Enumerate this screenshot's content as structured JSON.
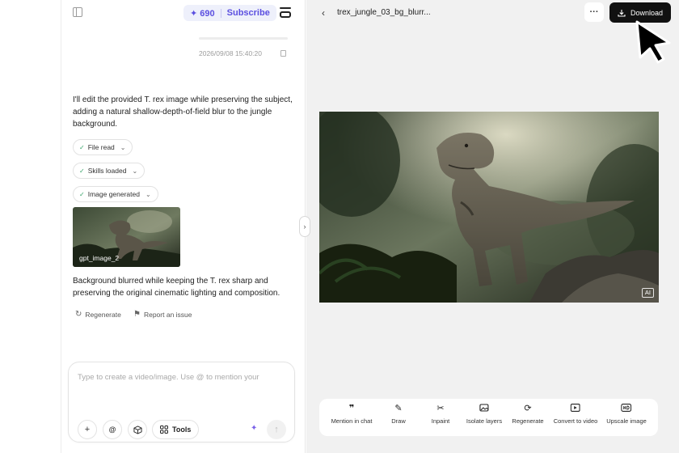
{
  "header": {
    "credits": "✦ 690",
    "subscribe_label": "Subscribe"
  },
  "chat": {
    "timestamp": "2026/09/08 15:40:20",
    "intro_text": "I'll edit the provided T. rex image while preserving the subject, adding a natural shallow-depth-of-field blur to the jungle background.",
    "steps": [
      {
        "label": "File read"
      },
      {
        "label": "Skills loaded"
      },
      {
        "label": "Image generated"
      }
    ],
    "thumbnail_label": "gpt_image_2",
    "result_text": "Background blurred while keeping the T. rex sharp and preserving the original cinematic lighting and composition.",
    "actions": {
      "regenerate": "Regenerate",
      "report": "Report an issue"
    }
  },
  "composer": {
    "placeholder": "Type to create a video/image. Use @ to mention your",
    "at_label": "@",
    "tools_label": "Tools"
  },
  "canvas": {
    "file_title": "trex_jungle_03_bg_blurr...",
    "more_label": "···",
    "download_label": "Download",
    "ai_badge": "AI",
    "tools": [
      {
        "label": "Mention in chat",
        "icon": "quote-icon"
      },
      {
        "label": "Draw",
        "icon": "brush-icon"
      },
      {
        "label": "Inpaint",
        "icon": "scissors-icon"
      },
      {
        "label": "Isolate layers",
        "icon": "layers-image-icon"
      },
      {
        "label": "Regenerate",
        "icon": "refresh-icon"
      },
      {
        "label": "Convert to video",
        "icon": "play-icon"
      },
      {
        "label": "Upscale image",
        "icon": "hd-icon"
      }
    ]
  },
  "colors": {
    "accent": "#5b4fe0",
    "canvas_bg": "#f1f1f1",
    "download_bg": "#111111"
  }
}
